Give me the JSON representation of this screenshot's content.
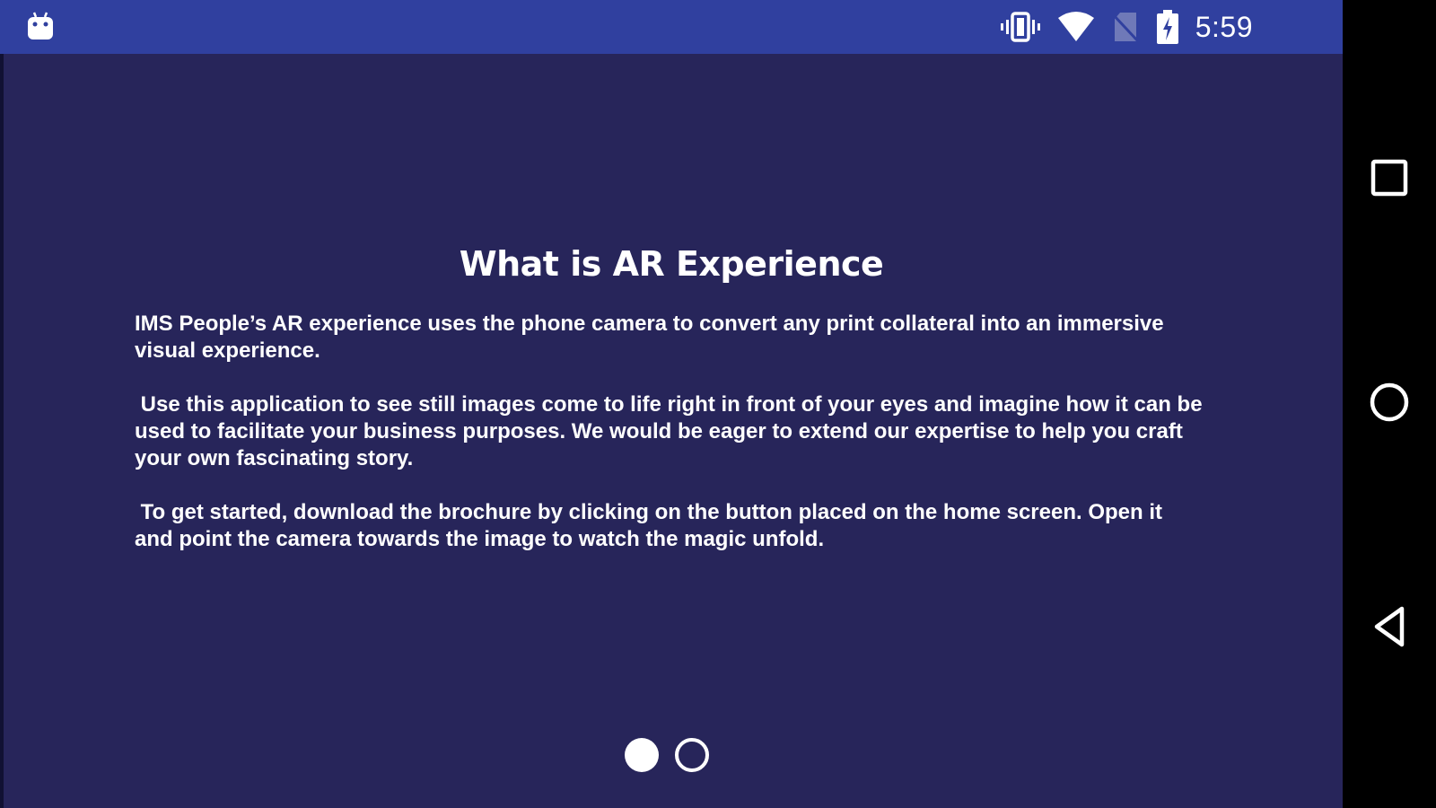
{
  "status_bar": {
    "time": "5:59",
    "icons": [
      "android-notification-icon",
      "vibrate-icon",
      "wifi-icon",
      "no-sim-icon",
      "battery-charging-icon"
    ],
    "background": "#30409f"
  },
  "content": {
    "title": "What is AR Experience",
    "paragraphs": [
      "IMS People’s AR experience uses the phone camera to convert any print collateral into an immersive visual experience.",
      " Use this application to see still images come to life right in front of your eyes and imagine how it can be used to facilitate your business purposes. We would be eager to extend our expertise to help you craft your own fascinating story.",
      " To get started, download the brochure by clicking on the button placed on the home screen. Open it and point the camera towards the image to watch the magic unfold."
    ],
    "background": "#27255a"
  },
  "pager": {
    "page_count": 2,
    "current_page": 1
  },
  "nav_bar": {
    "buttons": [
      "recents-icon",
      "home-icon",
      "back-icon"
    ],
    "background": "#000000"
  }
}
